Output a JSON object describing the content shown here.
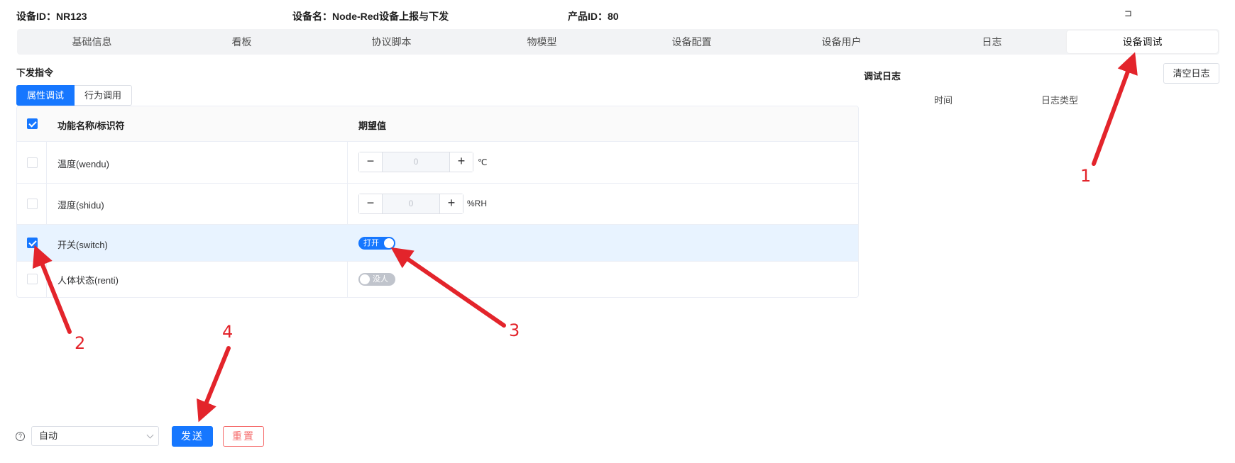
{
  "header": {
    "device_id": "设备ID：NR123",
    "device_name": "设备名：Node-Red设备上报与下发",
    "product_id": "产品ID：80",
    "exit_glyph": "⊐"
  },
  "tabs": [
    "基础信息",
    "看板",
    "协议脚本",
    "物模型",
    "设备配置",
    "设备用户",
    "日志",
    "设备调试"
  ],
  "command": {
    "title": "下发指令",
    "mode_tabs": [
      "属性调试",
      "行为调用"
    ],
    "table": {
      "headers": [
        "功能名称/标识符",
        "期望值"
      ],
      "rows": [
        {
          "name": "温度(wendu)",
          "value": "0",
          "unit": "℃",
          "checked": false
        },
        {
          "name": "湿度(shidu)",
          "value": "0",
          "unit": "%RH",
          "checked": false
        },
        {
          "name": "开关(switch)",
          "switch_label": "打开",
          "switch_on": true,
          "checked": true
        },
        {
          "name": "人体状态(renti)",
          "switch_label": "没人",
          "switch_on": false,
          "checked": false
        }
      ]
    },
    "stepper": {
      "minus": "−",
      "plus": "+"
    }
  },
  "log": {
    "title": "调试日志",
    "clear_label": "清空日志",
    "columns": [
      "时间",
      "日志类型"
    ]
  },
  "footer": {
    "help_glyph": "?",
    "select_value": "自动",
    "send_label": "发送",
    "reset_label": "重置"
  },
  "annotations": [
    "1",
    "2",
    "3",
    "4"
  ],
  "colors": {
    "primary": "#1677ff",
    "danger": "#f56c6c",
    "annotation": "#e3242b",
    "selected_row": "#e8f3ff"
  }
}
